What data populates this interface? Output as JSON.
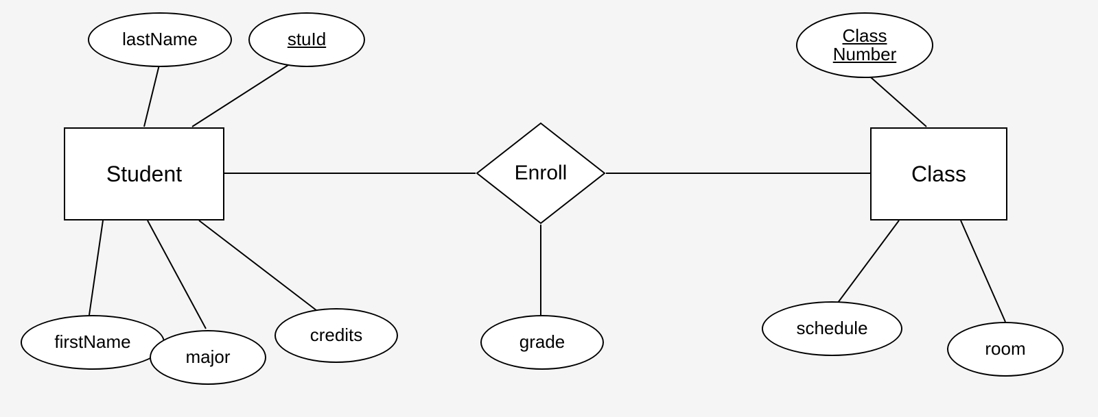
{
  "entities": {
    "student": {
      "label": "Student"
    },
    "class": {
      "label": "Class"
    }
  },
  "relationship": {
    "enroll": {
      "label": "Enroll"
    }
  },
  "attributes": {
    "lastName": {
      "label": "lastName"
    },
    "stuId": {
      "label": "stuId"
    },
    "firstName": {
      "label": "firstName"
    },
    "major": {
      "label": "major"
    },
    "credits": {
      "label": "credits"
    },
    "grade": {
      "label": "grade"
    },
    "classNumber": {
      "line1": "Class",
      "line2": "Number"
    },
    "schedule": {
      "label": "schedule"
    },
    "room": {
      "label": "room"
    }
  }
}
